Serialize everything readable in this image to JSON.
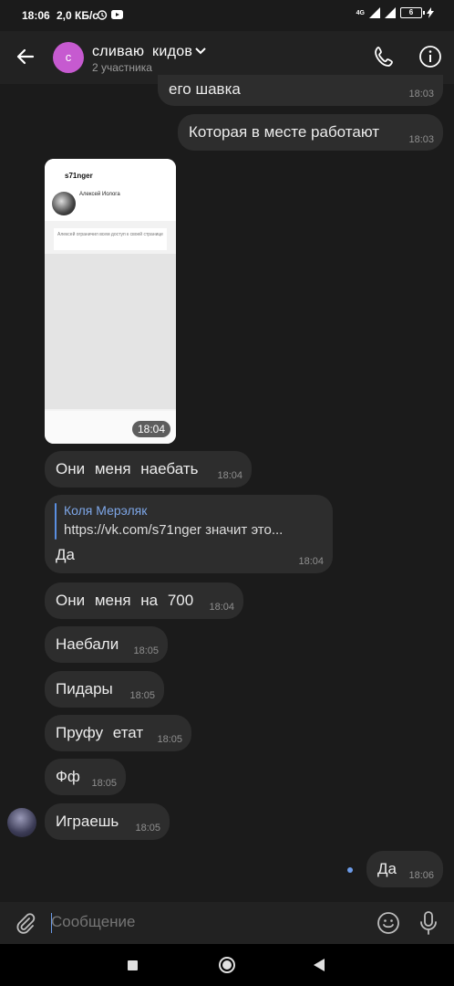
{
  "status_bar": {
    "time": "18:06",
    "speed": "2,0 КБ/с",
    "network": "4G",
    "battery": "6"
  },
  "header": {
    "title": "сливаю кидов",
    "subtitle": "2 участника"
  },
  "messages": [
    {
      "text": "его шавка",
      "time": "18:03"
    },
    {
      "text": "Которая в месте работают",
      "time": "18:03"
    },
    {
      "photo_time": "18:04",
      "photo_title": "s71nger",
      "photo_name": "Алексей Иолога",
      "photo_note": "Алексей ограничил всем доступ к своей странице"
    },
    {
      "text": "Они меня наебать",
      "time": "18:04"
    },
    {
      "reply_name": "Коля Мерэляк",
      "reply_text": "https://vk.com/s71nger значит это...",
      "text": "Да",
      "time": "18:04"
    },
    {
      "text": "Они меня на 700",
      "time": "18:04"
    },
    {
      "text": "Наебали",
      "time": "18:05"
    },
    {
      "text": "Пидары",
      "time": "18:05"
    },
    {
      "text": "Пруфу етат",
      "time": "18:05"
    },
    {
      "text": "Фф",
      "time": "18:05"
    },
    {
      "text": "Играешь",
      "time": "18:05"
    },
    {
      "text": "Да",
      "time": "18:06"
    }
  ],
  "composer": {
    "placeholder": "Сообщение"
  },
  "icons": {
    "back": "arrow-left-icon",
    "dropdown": "chevron-down-icon",
    "call": "phone-icon",
    "info": "info-icon",
    "attach": "paperclip-icon",
    "emoji": "smiley-icon",
    "mic": "microphone-icon"
  },
  "colors": {
    "background": "#1b1b1b",
    "bubble": "#2d2d2d",
    "accent": "#6c9be8",
    "avatar": "#c65ad0"
  }
}
